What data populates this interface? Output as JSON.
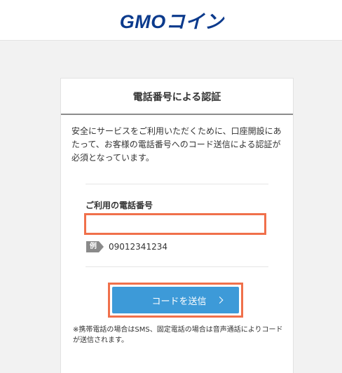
{
  "header": {
    "logo_text": "GMOコイン"
  },
  "card": {
    "title": "電話番号による認証",
    "description": "安全にサービスをご利用いただくために、口座開設にあたって、お客様の電話番号へのコード送信による認証が必須となっています。",
    "phone_field": {
      "label": "ご利用の電話番号",
      "value": "",
      "example_tag": "例",
      "example_value": "09012341234"
    },
    "submit_label": "コードを送信",
    "note": "※携帯電話の場合はSMS、固定電話の場合は音声通話によりコードが送信されます。"
  },
  "colors": {
    "brand": "#0b3a8c",
    "button": "#3d9ad8",
    "highlight": "#f0704b"
  }
}
